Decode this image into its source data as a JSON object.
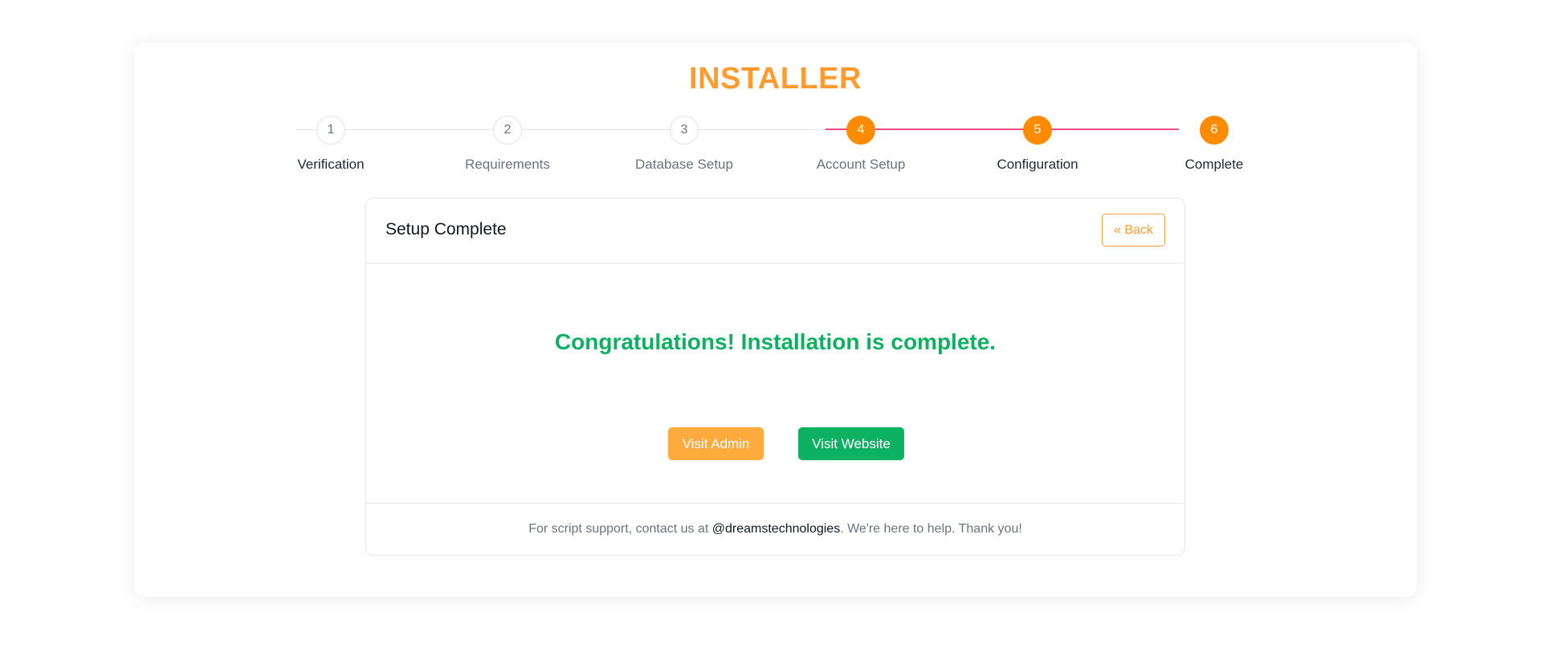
{
  "header": {
    "title": "INSTALLER"
  },
  "stepper": {
    "steps": [
      {
        "number": "1",
        "label": "Verification",
        "state": "inactive"
      },
      {
        "number": "2",
        "label": "Requirements",
        "state": "inactive"
      },
      {
        "number": "3",
        "label": "Database Setup",
        "state": "inactive"
      },
      {
        "number": "4",
        "label": "Account Setup",
        "state": "done"
      },
      {
        "number": "5",
        "label": "Configuration",
        "state": "done"
      },
      {
        "number": "6",
        "label": "Complete",
        "state": "done"
      }
    ]
  },
  "panel": {
    "title": "Setup Complete",
    "back_label": "« Back",
    "message": "Congratulations! Installation is complete.",
    "admin_button": "Visit Admin",
    "website_button": "Visit Website",
    "footer": {
      "prefix": "For script support, contact us at ",
      "handle": "@dreamstechnologies",
      "suffix": ". We're here to help. Thank you!"
    }
  },
  "colors": {
    "accent_orange": "#ff9b2f",
    "step_active": "#ff8c00",
    "progress_line": "#ef4b88",
    "success_green": "#0db162"
  }
}
